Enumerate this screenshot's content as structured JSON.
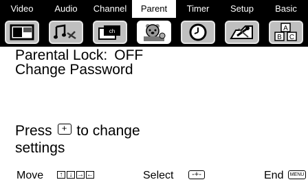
{
  "tabs": [
    {
      "label": "Video",
      "icon": "tv-icon",
      "active": false
    },
    {
      "label": "Audio",
      "icon": "music-notes-icon",
      "active": false
    },
    {
      "label": "Channel",
      "icon": "channel-icon",
      "active": false
    },
    {
      "label": "Parent",
      "icon": "parent-bear-icon",
      "active": true
    },
    {
      "label": "Timer",
      "icon": "clock-icon",
      "active": false
    },
    {
      "label": "Setup",
      "icon": "setup-tools-icon",
      "active": false
    },
    {
      "label": "Basic",
      "icon": "abc-blocks-icon",
      "active": false
    }
  ],
  "channel_icon_text": "ch",
  "basic_icon_letters": [
    "A",
    "B",
    "C"
  ],
  "main": {
    "parental_lock_label": "Parental Lock:",
    "parental_lock_value": "OFF",
    "change_password": "Change Password",
    "hint_prefix": "Press",
    "hint_suffix": "to change",
    "hint_line2": "settings"
  },
  "footer": {
    "move": "Move",
    "select": "Select",
    "end": "End",
    "menu_key": "MENU",
    "enter_glyph": "-+-",
    "arrow_glyphs": [
      "↑",
      "↓",
      "→",
      "←"
    ]
  },
  "colors": {
    "tabbar_bg": "#000000",
    "icon_bg": "#bfbfbf",
    "active_bg": "#ffffff"
  }
}
